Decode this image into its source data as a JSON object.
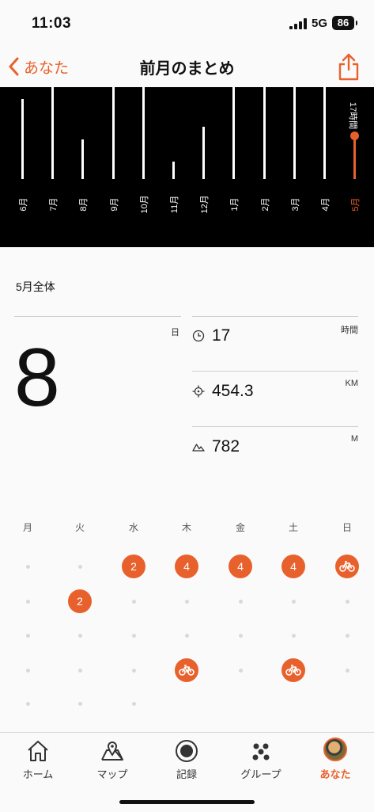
{
  "status_bar": {
    "time": "11:03",
    "network": "5G",
    "battery": "86"
  },
  "nav": {
    "back_label": "あなた",
    "title": "前月のまとめ"
  },
  "chart_data": {
    "type": "bar",
    "categories": [
      "6月",
      "7月",
      "8月",
      "9月",
      "10月",
      "11月",
      "12月",
      "1月",
      "2月",
      "3月",
      "4月",
      "5月"
    ],
    "values": [
      0.87,
      1.0,
      0.43,
      1.0,
      1.0,
      0.19,
      0.57,
      1.0,
      1.0,
      1.0,
      1.0,
      0.47
    ],
    "current_index": 11,
    "current_label": "17時間",
    "highlight_color": "#e8612c"
  },
  "summary": {
    "title": "5月全体",
    "days_unit": "日",
    "days_value": "8",
    "stats": [
      {
        "icon": "clock-icon",
        "value": "17",
        "unit": "時間"
      },
      {
        "icon": "location-target-icon",
        "value": "454.3",
        "unit": "KM"
      },
      {
        "icon": "elevation-icon",
        "value": "782",
        "unit": "M"
      }
    ]
  },
  "calendar": {
    "weekdays": [
      "月",
      "火",
      "水",
      "木",
      "金",
      "土",
      "日"
    ],
    "weeks": [
      [
        "dot",
        "dot",
        "2",
        "4",
        "4",
        "4",
        "bike"
      ],
      [
        "dot",
        "2",
        "dot",
        "dot",
        "dot",
        "dot",
        "dot"
      ],
      [
        "dot",
        "dot",
        "dot",
        "dot",
        "dot",
        "dot",
        "dot"
      ],
      [
        "dot",
        "dot",
        "dot",
        "bike",
        "dot",
        "bike",
        "dot"
      ],
      [
        "dot",
        "dot",
        "dot",
        "",
        "",
        "",
        ""
      ]
    ]
  },
  "tabs": [
    {
      "label": "ホーム",
      "icon": "home-icon",
      "active": false
    },
    {
      "label": "マップ",
      "icon": "map-icon",
      "active": false
    },
    {
      "label": "記録",
      "icon": "record-icon",
      "active": false
    },
    {
      "label": "グループ",
      "icon": "group-icon",
      "active": false
    },
    {
      "label": "あなた",
      "icon": "avatar",
      "active": true
    }
  ],
  "colors": {
    "accent": "#e8612c",
    "chart_bg": "#000000"
  }
}
